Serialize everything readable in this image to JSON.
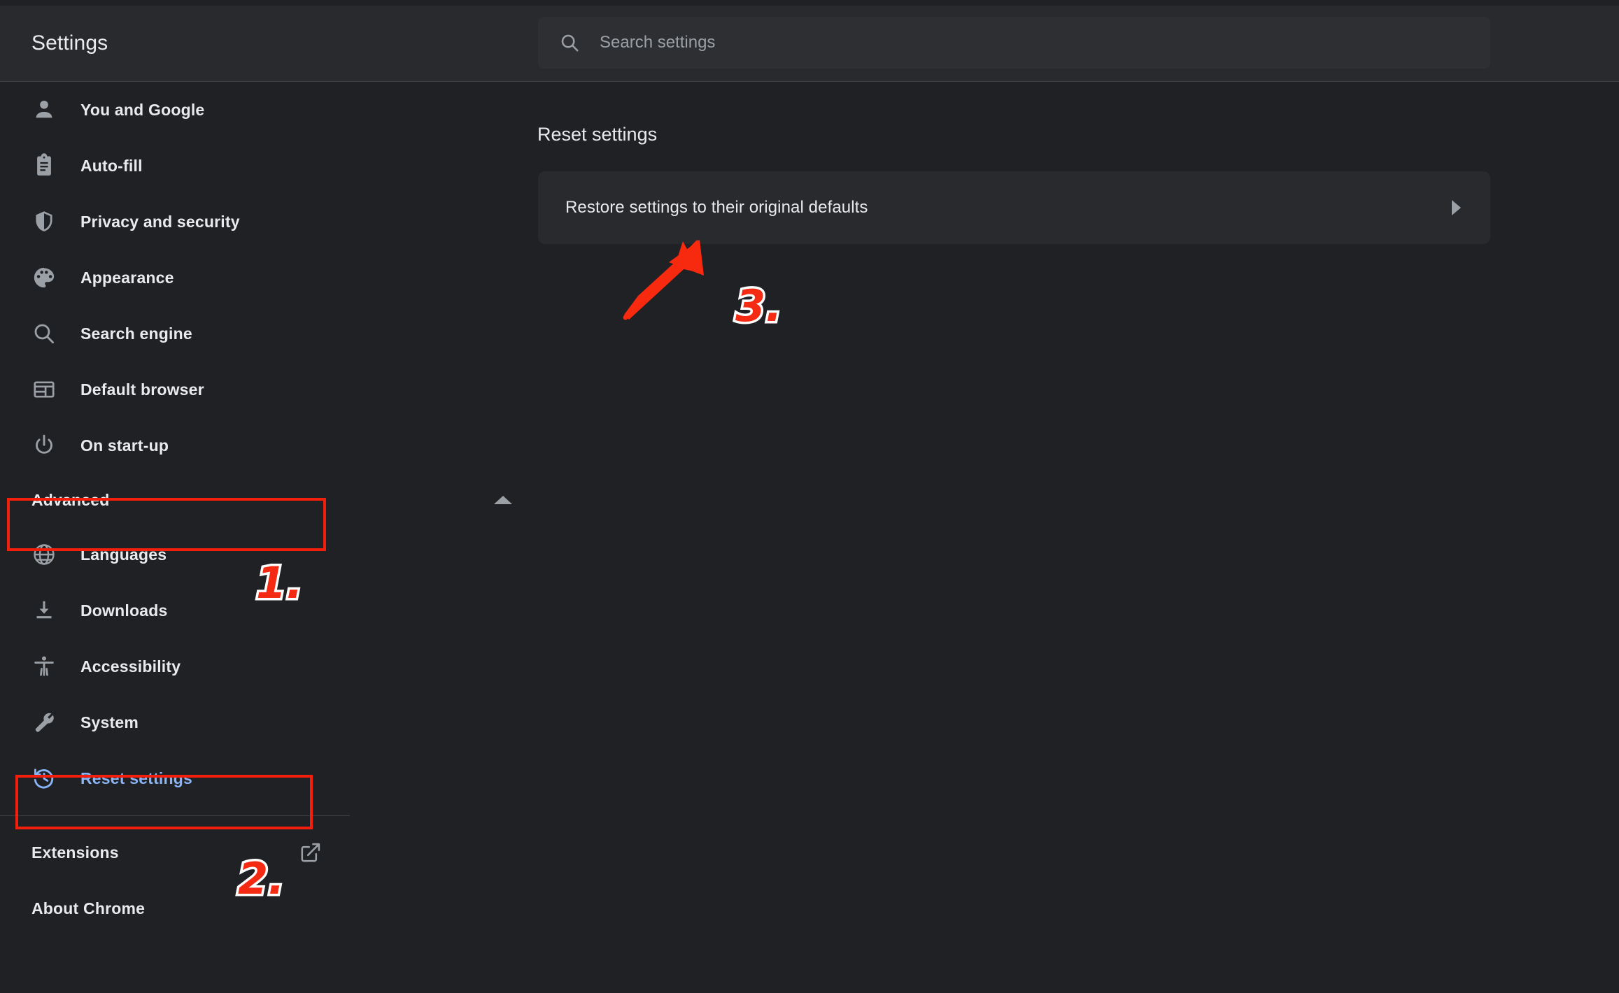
{
  "header": {
    "title": "Settings",
    "search": {
      "placeholder": "Search settings",
      "value": "",
      "icon": "search-icon"
    }
  },
  "sidebar": {
    "items": [
      {
        "label": "You and Google",
        "icon": "person-icon",
        "active": false
      },
      {
        "label": "Auto-fill",
        "icon": "clipboard-icon",
        "active": false
      },
      {
        "label": "Privacy and security",
        "icon": "shield-icon",
        "active": false
      },
      {
        "label": "Appearance",
        "icon": "palette-icon",
        "active": false
      },
      {
        "label": "Search engine",
        "icon": "search-icon",
        "active": false
      },
      {
        "label": "Default browser",
        "icon": "browser-window-icon",
        "active": false
      },
      {
        "label": "On start-up",
        "icon": "power-icon",
        "active": false
      }
    ],
    "advanced": {
      "label": "Advanced",
      "expanded": true,
      "icon": "chevron-up-icon"
    },
    "advanced_items": [
      {
        "label": "Languages",
        "icon": "globe-icon",
        "active": false
      },
      {
        "label": "Downloads",
        "icon": "download-icon",
        "active": false
      },
      {
        "label": "Accessibility",
        "icon": "accessibility-icon",
        "active": false
      },
      {
        "label": "System",
        "icon": "wrench-icon",
        "active": false
      },
      {
        "label": "Reset settings",
        "icon": "history-icon",
        "active": true
      }
    ],
    "footer": [
      {
        "label": "Extensions",
        "icon": "external-link-icon",
        "has_external": true
      },
      {
        "label": "About Chrome",
        "icon": "",
        "has_external": false
      }
    ]
  },
  "main": {
    "section_title": "Reset settings",
    "card": {
      "label": "Restore settings to their original defaults",
      "chevron": "chevron-right-icon"
    }
  },
  "annotations": {
    "step1": "1.",
    "step2": "2.",
    "step3": "3.",
    "highlight_color": "#f21f0c",
    "number_color": "#f42a12",
    "arrow_color": "#f7290f"
  },
  "colors": {
    "page_background": "#202124",
    "surface": "#292a2d",
    "accent_blue": "#8ab4f8",
    "text_primary": "#e8eaed",
    "text_secondary": "#9aa0a6",
    "divider": "#3c4043"
  }
}
